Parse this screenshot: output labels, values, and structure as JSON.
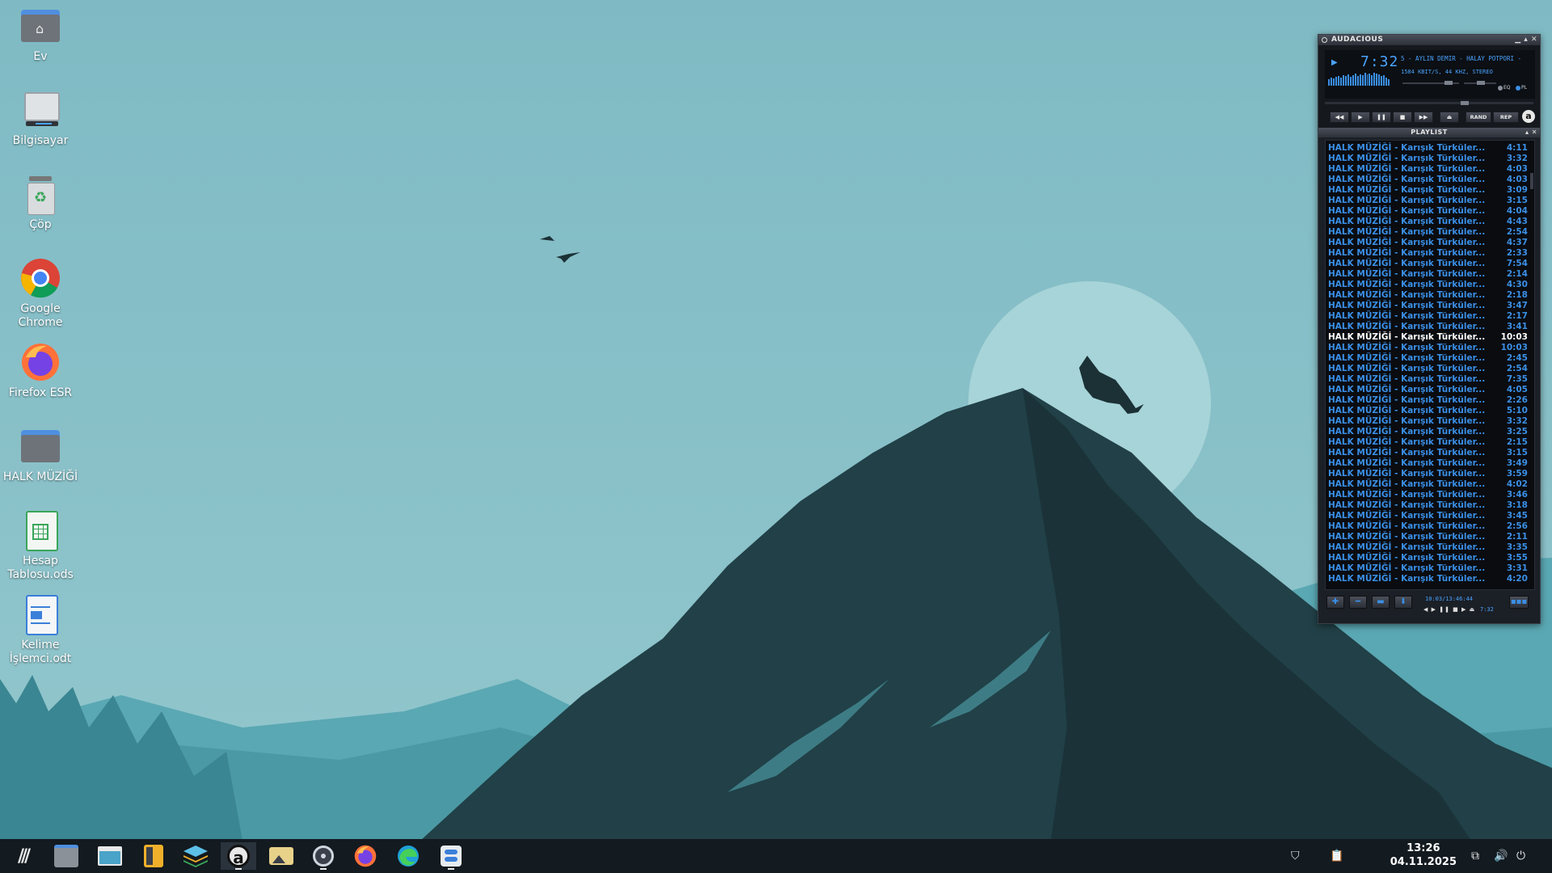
{
  "desktop": {
    "icons": [
      {
        "label": "Ev"
      },
      {
        "label": "Bilgisayar"
      },
      {
        "label": "Çöp"
      },
      {
        "label": "Google Chrome"
      },
      {
        "label": "Firefox ESR"
      },
      {
        "label": "HALK MÜZİĞİ"
      },
      {
        "label": "Hesap Tablosu.ods"
      },
      {
        "label": "Kelime İşlemci.odt"
      }
    ]
  },
  "audacious": {
    "title": "AUDACIOUS",
    "time": "7:32",
    "marquee": "5 - AYLIN DEMIR - HALAY POTPORI -",
    "info": "1584 KBIT/S, 44 KHZ, STEREO",
    "eq_label": "EQ",
    "pl_label": "PL",
    "rand_label": "RAND",
    "rep_label": "REP",
    "logo": "a",
    "playlist_title": "PLAYLIST",
    "playlist_total": "10:03/13:46:44",
    "playlist_small_time": "7:32",
    "current_index": 18,
    "tracks": [
      {
        "title": "HALK MÜZİĞİ - Karışık Türküler...",
        "time": "4:11"
      },
      {
        "title": "HALK MÜZİĞİ - Karışık Türküler...",
        "time": "3:32"
      },
      {
        "title": "HALK MÜZİĞİ - Karışık Türküler...",
        "time": "4:03"
      },
      {
        "title": "HALK MÜZİĞİ - Karışık Türküler...",
        "time": "4:03"
      },
      {
        "title": "HALK MÜZİĞİ - Karışık Türküler...",
        "time": "3:09"
      },
      {
        "title": "HALK MÜZİĞİ - Karışık Türküler...",
        "time": "3:15"
      },
      {
        "title": "HALK MÜZİĞİ - Karışık Türküler...",
        "time": "4:04"
      },
      {
        "title": "HALK MÜZİĞİ - Karışık Türküler...",
        "time": "4:43"
      },
      {
        "title": "HALK MÜZİĞİ - Karışık Türküler...",
        "time": "2:54"
      },
      {
        "title": "HALK MÜZİĞİ - Karışık Türküler...",
        "time": "4:37"
      },
      {
        "title": "HALK MÜZİĞİ - Karışık Türküler...",
        "time": "2:33"
      },
      {
        "title": "HALK MÜZİĞİ - Karışık Türküler...",
        "time": "7:54"
      },
      {
        "title": "HALK MÜZİĞİ - Karışık Türküler...",
        "time": "2:14"
      },
      {
        "title": "HALK MÜZİĞİ - Karışık Türküler...",
        "time": "4:30"
      },
      {
        "title": "HALK MÜZİĞİ - Karışık Türküler...",
        "time": "2:18"
      },
      {
        "title": "HALK MÜZİĞİ - Karışık Türküler...",
        "time": "3:47"
      },
      {
        "title": "HALK MÜZİĞİ - Karışık Türküler...",
        "time": "2:17"
      },
      {
        "title": "HALK MÜZİĞİ - Karışık Türküler...",
        "time": "3:41"
      },
      {
        "title": "HALK MÜZİĞİ - Karışık Türküler...",
        "time": "10:03"
      },
      {
        "title": "HALK MÜZİĞİ - Karışık Türküler...",
        "time": "10:03"
      },
      {
        "title": "HALK MÜZİĞİ - Karışık Türküler...",
        "time": "2:45"
      },
      {
        "title": "HALK MÜZİĞİ - Karışık Türküler...",
        "time": "2:54"
      },
      {
        "title": "HALK MÜZİĞİ - Karışık Türküler...",
        "time": "7:35"
      },
      {
        "title": "HALK MÜZİĞİ - Karışık Türküler...",
        "time": "4:05"
      },
      {
        "title": "HALK MÜZİĞİ - Karışık Türküler...",
        "time": "2:26"
      },
      {
        "title": "HALK MÜZİĞİ - Karışık Türküler...",
        "time": "5:10"
      },
      {
        "title": "HALK MÜZİĞİ - Karışık Türküler...",
        "time": "3:32"
      },
      {
        "title": "HALK MÜZİĞİ - Karışık Türküler...",
        "time": "3:25"
      },
      {
        "title": "HALK MÜZİĞİ - Karışık Türküler...",
        "time": "2:15"
      },
      {
        "title": "HALK MÜZİĞİ - Karışık Türküler...",
        "time": "3:15"
      },
      {
        "title": "HALK MÜZİĞİ - Karışık Türküler...",
        "time": "3:49"
      },
      {
        "title": "HALK MÜZİĞİ - Karışık Türküler...",
        "time": "3:59"
      },
      {
        "title": "HALK MÜZİĞİ - Karışık Türküler...",
        "time": "4:02"
      },
      {
        "title": "HALK MÜZİĞİ - Karışık Türküler...",
        "time": "3:46"
      },
      {
        "title": "HALK MÜZİĞİ - Karışık Türküler...",
        "time": "3:18"
      },
      {
        "title": "HALK MÜZİĞİ - Karışık Türküler...",
        "time": "3:45"
      },
      {
        "title": "HALK MÜZİĞİ - Karışık Türküler...",
        "time": "2:56"
      },
      {
        "title": "HALK MÜZİĞİ - Karışık Türküler...",
        "time": "2:11"
      },
      {
        "title": "HALK MÜZİĞİ - Karışık Türküler...",
        "time": "3:35"
      },
      {
        "title": "HALK MÜZİĞİ - Karışık Türküler...",
        "time": "3:55"
      },
      {
        "title": "HALK MÜZİĞİ - Karışık Türküler...",
        "time": "3:31"
      },
      {
        "title": "HALK MÜZİĞİ - Karışık Türküler...",
        "time": "4:20"
      }
    ]
  },
  "taskbar": {
    "time": "13:26",
    "date": "04.11.2025",
    "apps": [
      "launcher-icon",
      "file-manager-icon",
      "terminal-icon",
      "calculator-icon",
      "layers-icon",
      "audacious-icon",
      "image-viewer-icon",
      "sound-icon",
      "firefox-icon",
      "edge-icon",
      "settings-icon"
    ]
  },
  "colors": {
    "sky": "#86bfc6",
    "mountain_dark": "#1f3a40",
    "accent_blue": "#3b8fe6",
    "taskbar": "#131a20"
  }
}
